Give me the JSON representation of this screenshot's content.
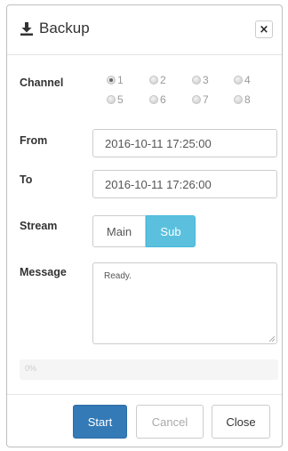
{
  "dialog": {
    "title": "Backup",
    "title_icon": "download-icon",
    "close_symbol": "×"
  },
  "channel": {
    "label": "Channel",
    "options": [
      {
        "label": "1",
        "checked": true
      },
      {
        "label": "2",
        "checked": false
      },
      {
        "label": "3",
        "checked": false
      },
      {
        "label": "4",
        "checked": false
      },
      {
        "label": "5",
        "checked": false
      },
      {
        "label": "6",
        "checked": false
      },
      {
        "label": "7",
        "checked": false
      },
      {
        "label": "8",
        "checked": false
      }
    ]
  },
  "from": {
    "label": "From",
    "value": "2016-10-11 17:25:00"
  },
  "to": {
    "label": "To",
    "value": "2016-10-11 17:26:00"
  },
  "stream": {
    "label": "Stream",
    "main_label": "Main",
    "sub_label": "Sub",
    "selected": "Sub",
    "selected_color": "#5bc0de"
  },
  "message": {
    "label": "Message",
    "value": "Ready."
  },
  "progress": {
    "value": 0,
    "text": "0%"
  },
  "buttons": {
    "start": "Start",
    "cancel": "Cancel",
    "close": "Close",
    "start_color": "#337ab7"
  }
}
